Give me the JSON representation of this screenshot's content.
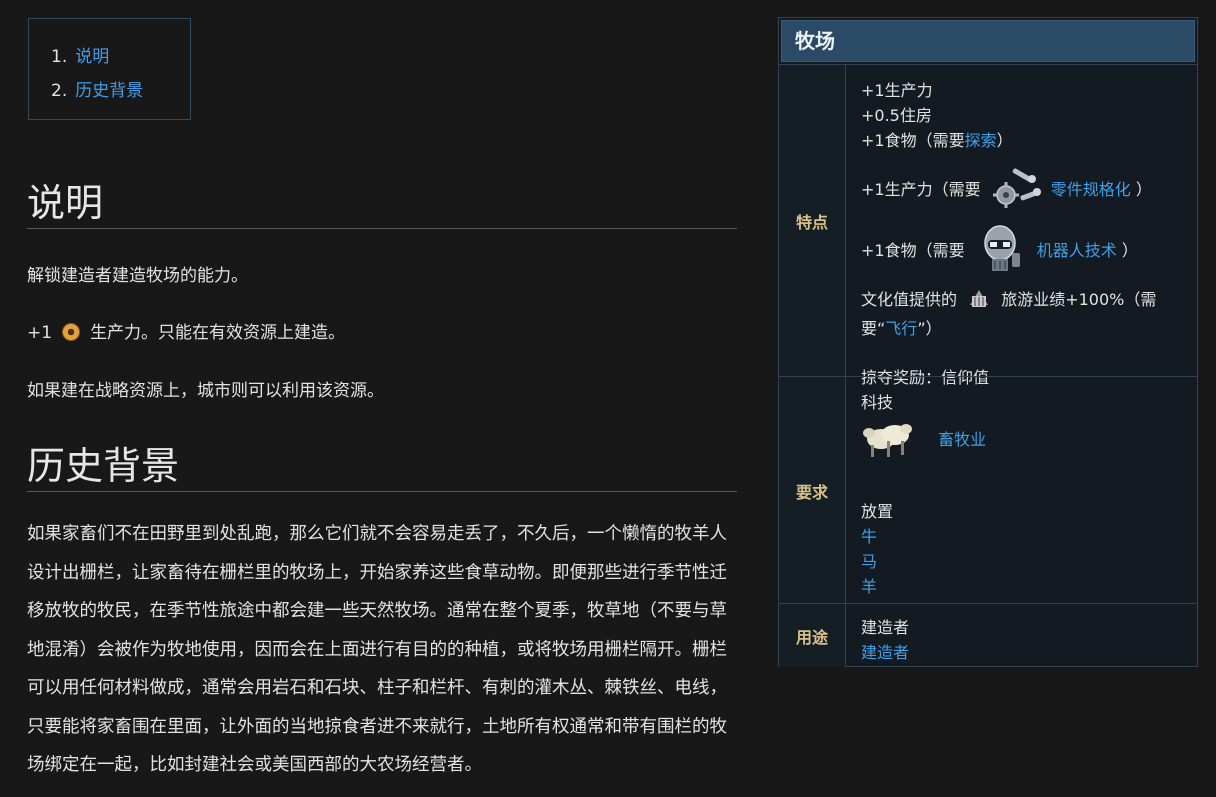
{
  "toc": {
    "items": [
      {
        "num": "1.",
        "label": "说明"
      },
      {
        "num": "2.",
        "label": "历史背景"
      }
    ]
  },
  "main": {
    "section1_title": "说明",
    "line1": "解锁建造者建造牧场的能力。",
    "line2_prefix": "+1",
    "line2_icon": "production-icon",
    "line2_suffix": "生产力。只能在有效资源上建造。",
    "line3": "如果建在战略资源上，城市则可以利用该资源。",
    "section2_title": "历史背景",
    "history": "如果家畜们不在田野里到处乱跑，那么它们就不会容易走丢了，不久后，一个懒惰的牧羊人设计出栅栏，让家畜待在栅栏里的牧场上，开始家养这些食草动物。即便那些进行季节性迁移放牧的牧民，在季节性旅途中都会建一些天然牧场。通常在整个夏季，牧草地（不要与草地混淆）会被作为牧地使用，因而会在上面进行有目的的种植，或将牧场用栅栏隔开。栅栏可以用任何材料做成，通常会用岩石和石块、柱子和栏杆、有刺的灌木丛、棘铁丝、电线，只要能将家畜围在里面，让外面的当地掠食者进不来就行，土地所有权通常和带有围栏的牧场绑定在一起，比如封建社会或美国西部的大农场经营者。"
  },
  "infobox": {
    "title": "牧场",
    "features": {
      "label": "特点",
      "l1": "+1生产力",
      "l2": "+0.5住房",
      "l3_prefix": "+1食物（需要",
      "l3_link": "探索",
      "l3_suffix": "）",
      "l4_prefix": "+1生产力（需要",
      "l4_link": "零件规格化",
      "l4_suffix": "）",
      "l5_prefix": "+1食物（需要",
      "l5_link": "机器人技术",
      "l5_suffix": "）",
      "l6_prefix": "文化值提供的",
      "l6_mid": "旅游业绩+100%（需",
      "l7_prefix": "要“",
      "l7_link": "飞行",
      "l7_suffix": "”）",
      "l8": "掠夺奖励：信仰值"
    },
    "requirements": {
      "label": "要求",
      "tech_heading": "科技",
      "tech_link": "畜牧业",
      "placement_heading": "放置",
      "resources": [
        "牛",
        "马",
        "羊"
      ]
    },
    "usage": {
      "label": "用途",
      "l1": "建造者",
      "l2": "建造者"
    }
  },
  "colors": {
    "background": "#181818",
    "link": "#3ea0e8",
    "infobox_title_bg": "#2b4a66",
    "infobox_label": "#d8c08a"
  }
}
